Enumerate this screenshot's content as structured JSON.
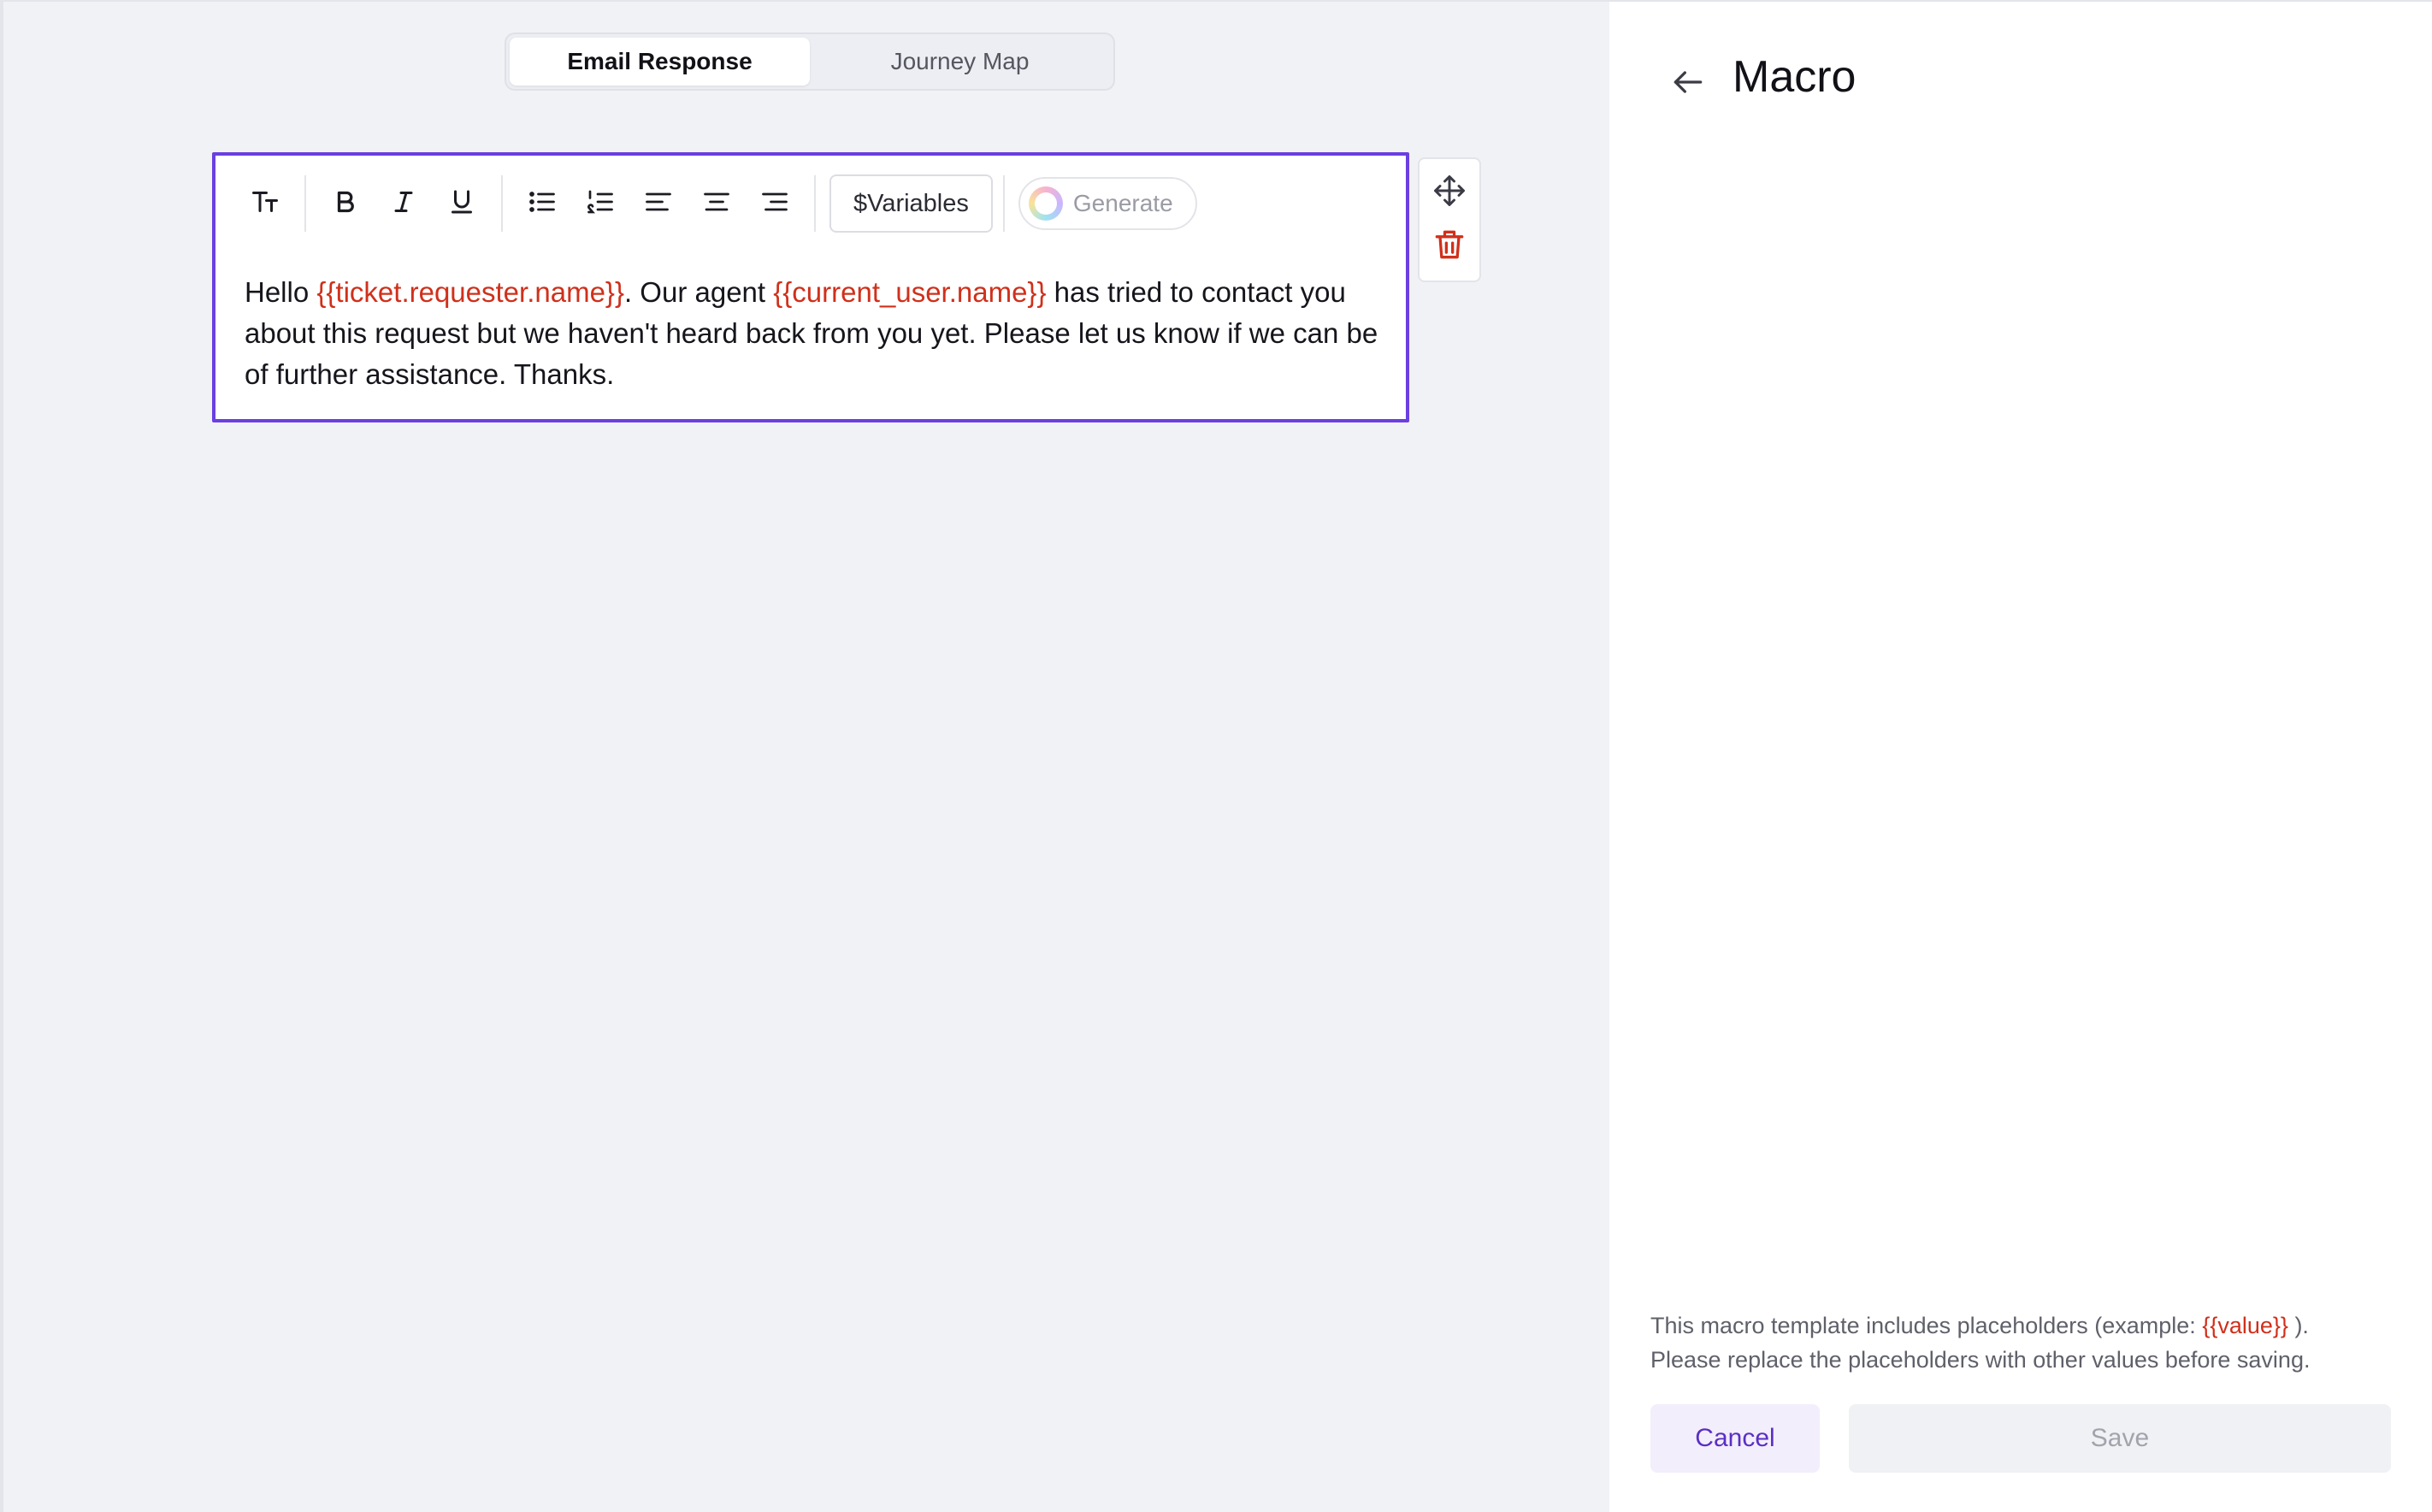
{
  "tabs": [
    {
      "label": "Email Response",
      "active": true
    },
    {
      "label": "Journey Map",
      "active": false
    }
  ],
  "toolbar": {
    "icons": [
      "text-size-icon",
      "bold-icon",
      "italic-icon",
      "underline-icon",
      "bullet-list-icon",
      "numbered-list-icon",
      "align-left-icon",
      "align-center-icon",
      "align-right-icon"
    ],
    "variables_label": "$Variables",
    "generate_label": "Generate"
  },
  "editor": {
    "text_1": "Hello ",
    "placeholder_1": "{{ticket.requester.name}}",
    "text_2": ". Our agent ",
    "placeholder_2": "{{current_user.name}}",
    "text_3": " has tried to contact you about this request but we haven't heard back from you yet. Please let us know if we can be of further assistance. Thanks."
  },
  "side_actions": [
    "move-icon",
    "trash-icon"
  ],
  "panel": {
    "title": "Macro",
    "notice_1": "This macro template includes placeholders (example: ",
    "notice_placeholder": "{{value}}",
    "notice_2": " ).",
    "notice_3": "Please replace the placeholders with other values before saving.",
    "cancel_label": "Cancel",
    "save_label": "Save"
  },
  "colors": {
    "accent": "#6b3fe0",
    "placeholder": "#d0301b",
    "danger": "#d0301b"
  }
}
